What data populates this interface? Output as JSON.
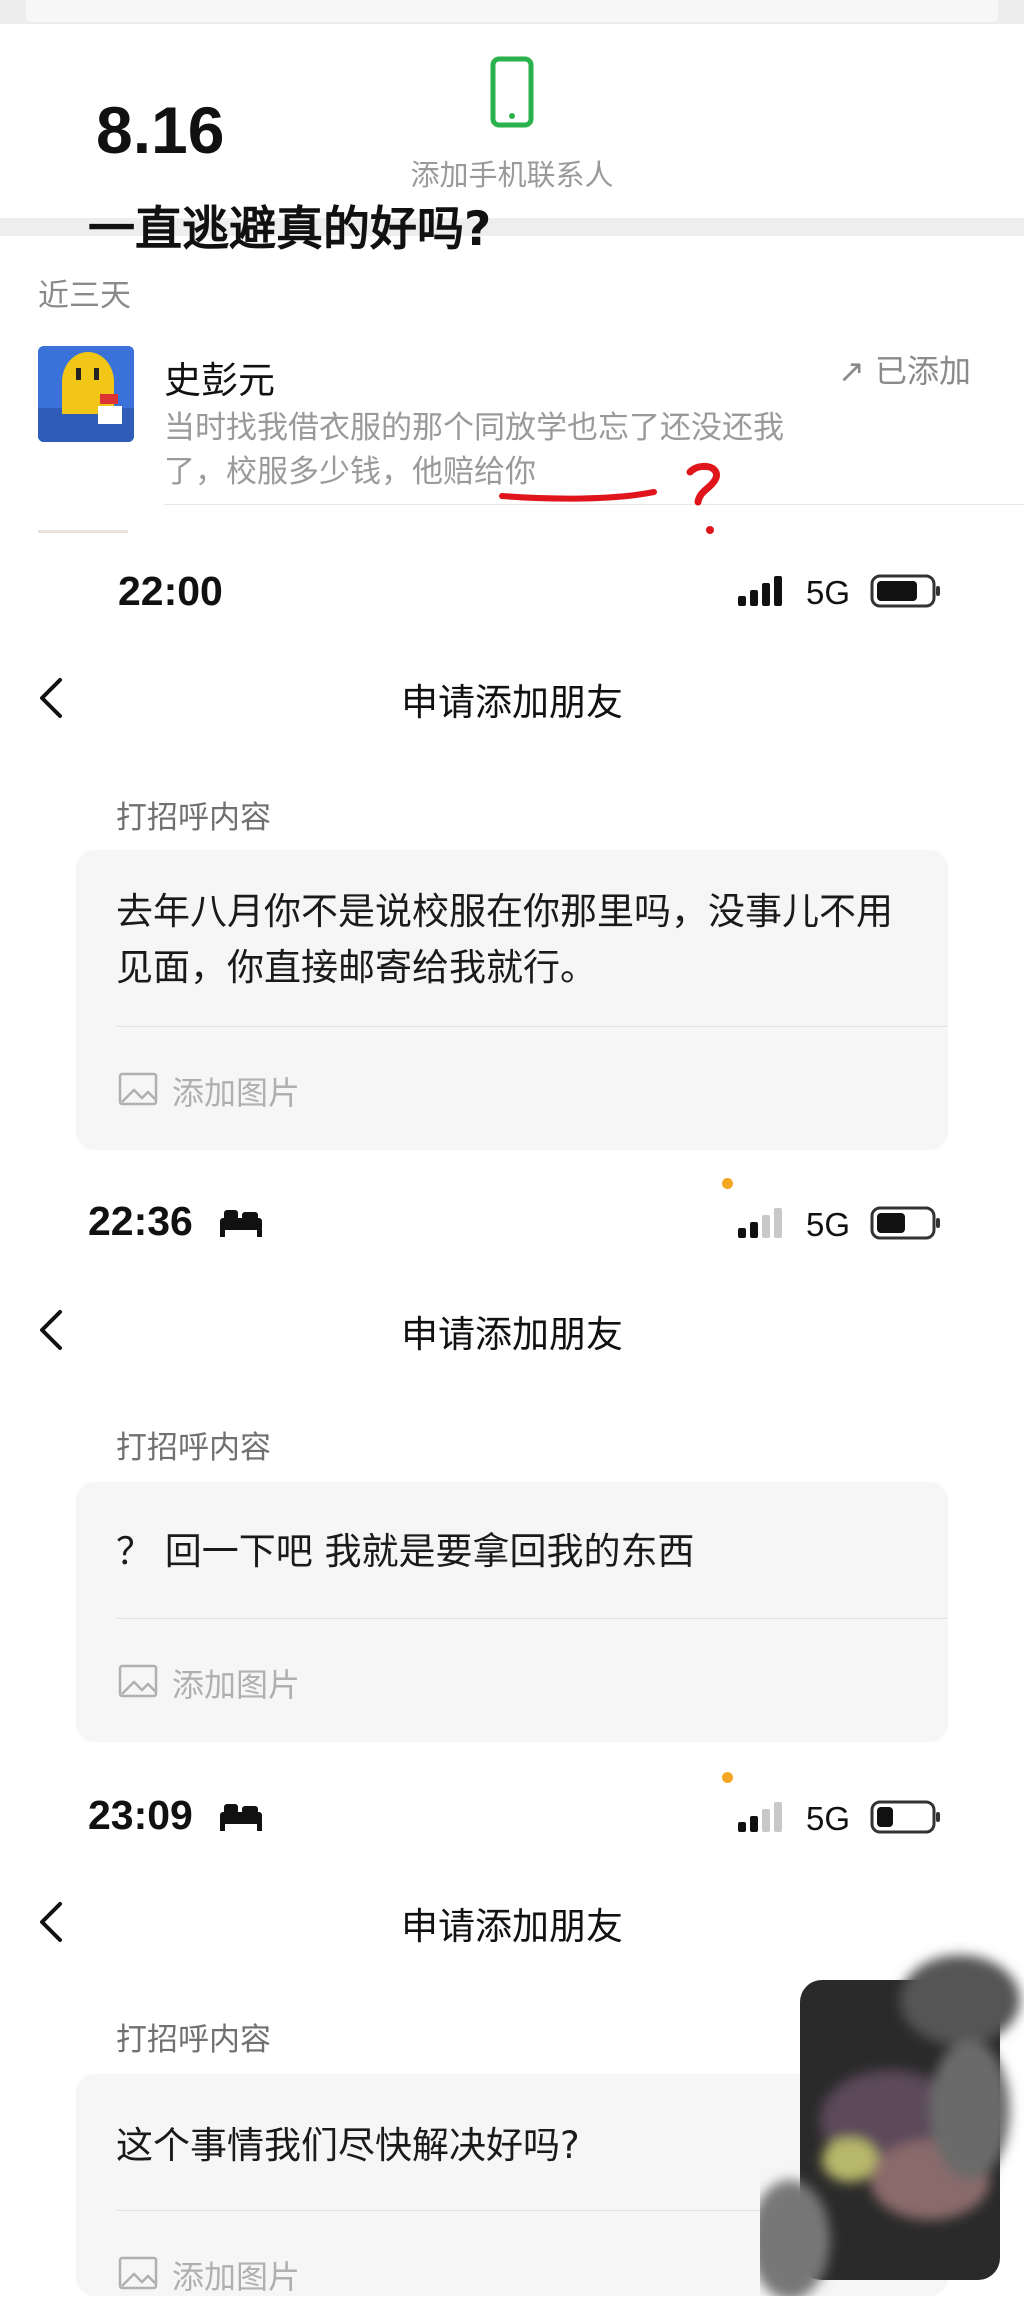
{
  "post": {
    "date": "8.16",
    "headline": "一直逃避真的好吗?"
  },
  "contacts_panel": {
    "add_phone_contact_label": "添加手机联系人",
    "recent_section": "近三天",
    "contact": {
      "name": "史彭元",
      "message": "当时找我借衣服的那个同放学也忘了还没还我了，校服多少钱，他赔给你",
      "status": "↗ 已添加"
    }
  },
  "requests": [
    {
      "time": "22:00",
      "network": "5G",
      "sleep_mode": false,
      "title": "申请添加朋友",
      "greeting_label": "打招呼内容",
      "greeting_text": "去年八月你不是说校服在你那里吗，没事儿不用见面，你直接邮寄给我就行。",
      "add_image_label": "添加图片"
    },
    {
      "time": "22:36",
      "network": "5G",
      "sleep_mode": true,
      "title": "申请添加朋友",
      "greeting_label": "打招呼内容",
      "greeting_text": "？ 回一下吧 我就是要拿回我的东西",
      "add_image_label": "添加图片"
    },
    {
      "time": "23:09",
      "network": "5G",
      "sleep_mode": true,
      "title": "申请添加朋友",
      "greeting_label": "打招呼内容",
      "greeting_text": "这个事情我们尽快解决好吗?",
      "add_image_label": "添加图片"
    }
  ],
  "colors": {
    "phone_icon": "#2bb24c",
    "red_mark": "#e0141b",
    "orange_dot": "#f5a623",
    "card_bg": "#f6f6f6"
  },
  "icons": [
    "phone-icon",
    "back-arrow-icon",
    "signal-icon",
    "battery-icon",
    "bed-icon",
    "image-icon"
  ]
}
